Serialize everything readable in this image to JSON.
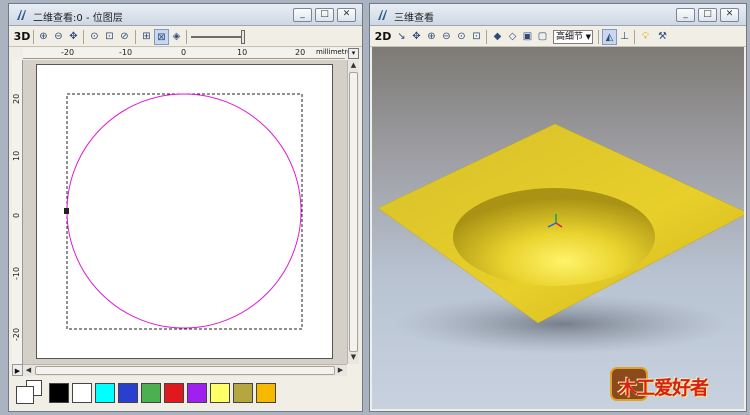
{
  "left_window": {
    "title": "二维查看:0 - 位图层",
    "toolbar": {
      "mode_label": "3D"
    },
    "ruler_unit": "millimetres",
    "ruler_h_ticks": [
      "-20",
      "-10",
      "0",
      "10",
      "20"
    ],
    "ruler_v_ticks": [
      "20",
      "10",
      "0",
      "-10",
      "-20"
    ]
  },
  "right_window": {
    "title": "三维查看",
    "toolbar": {
      "mode_label": "2D",
      "quality_select": "高细节"
    }
  },
  "palette": {
    "colors": [
      "#000000",
      "#ffffff",
      "#00ffff",
      "#2a3fd0",
      "#4caf50",
      "#e0191f",
      "#a020f0",
      "#ffff66",
      "#b5a642",
      "#f7b900"
    ]
  },
  "shapes": {
    "circle_color": "#e11ad4",
    "surface_color": "#e8cf2a"
  },
  "watermark": {
    "text": "木工爱好者"
  }
}
